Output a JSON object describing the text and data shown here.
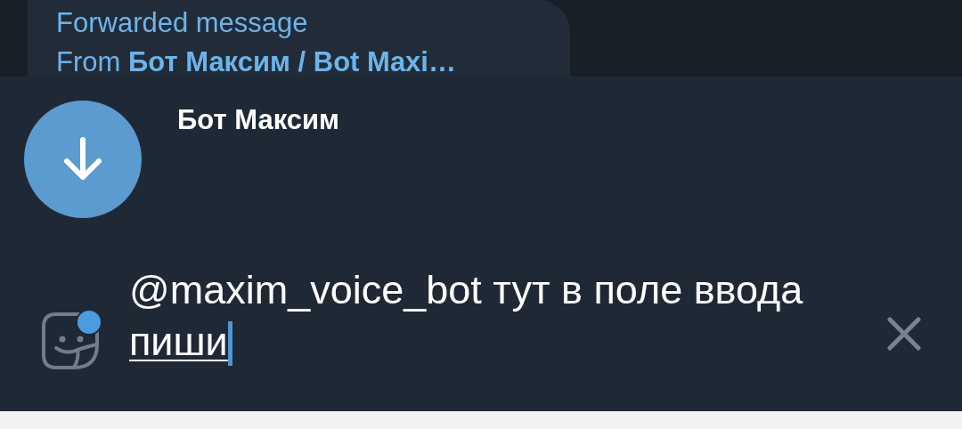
{
  "forwarded": {
    "title": "Forwarded message",
    "from": "From **Бот Максим / Bot Maxi…**"
  },
  "bot": {
    "name": "Бот Максим"
  },
  "input": {
    "value": "@maxim_voice_bot тут в поле ввода ",
    "underlined": "пиши",
    "sticker_badge": true
  }
}
